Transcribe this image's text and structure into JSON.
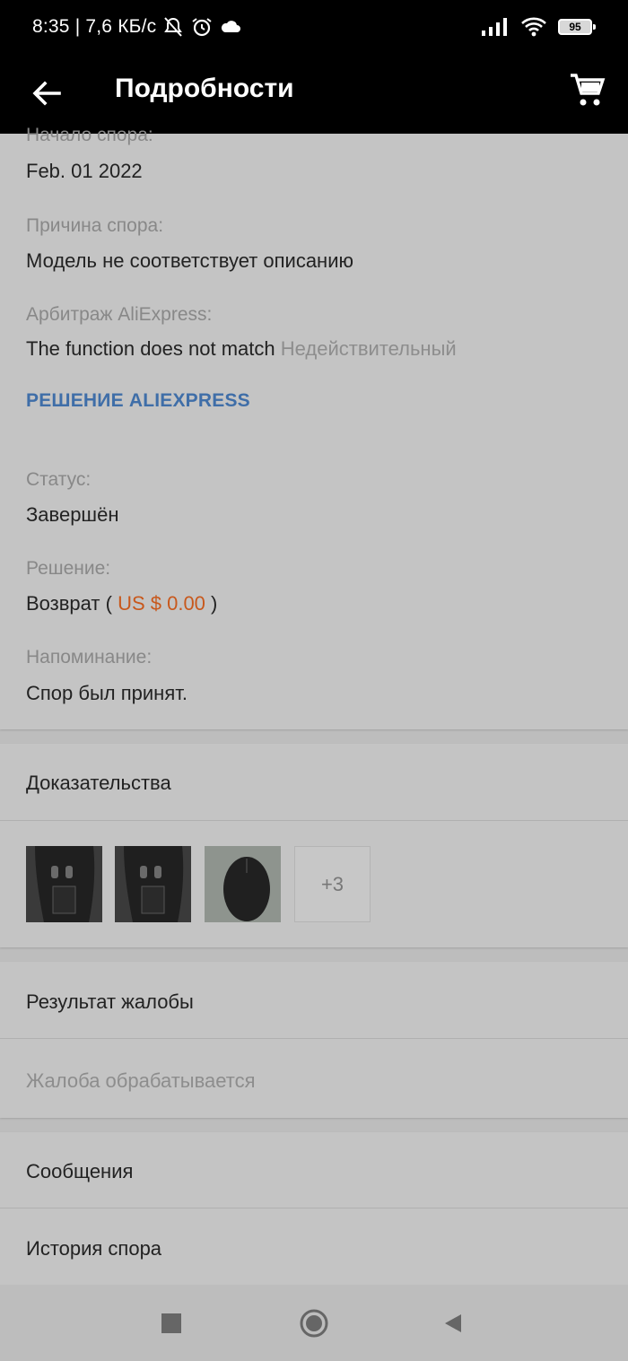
{
  "status_bar": {
    "time": "8:35",
    "speed": "| 7,6 КБ/с",
    "battery": "95",
    "icons": [
      "mute-icon",
      "alarm-icon",
      "cloud-icon",
      "signal-icon",
      "wifi-icon",
      "battery-icon"
    ]
  },
  "header": {
    "title": "Подробности",
    "back_icon": "arrow-left-icon",
    "cart_icon": "cart-icon"
  },
  "details": {
    "dispute_start_label": "Начало спора:",
    "dispute_start_value": "Feb. 01 2022",
    "reason_label": "Причина спора:",
    "reason_value": "Модель не соответствует описанию",
    "arbitration_label": "Арбитраж AliExpress:",
    "arbitration_value": "The function does not match",
    "arbitration_status": "Недействительный",
    "decision_link": "РЕШЕНИЕ ALIEXPRESS",
    "status_label": "Статус:",
    "status_value": "Завершён",
    "resolution_label": "Решение:",
    "resolution_prefix": "Возврат (",
    "resolution_amount": "US $ 0.00",
    "resolution_suffix": ")",
    "reminder_label": "Напоминание:",
    "reminder_value": "Спор был принят."
  },
  "evidence": {
    "title": "Доказательства",
    "more_count": "+3"
  },
  "complaint": {
    "title": "Результат жалобы",
    "status": "Жалоба обрабатывается"
  },
  "menu": {
    "messages": "Сообщения",
    "history": "История спора"
  },
  "colors": {
    "accent_link": "#3f6ea8",
    "price": "#c8581c",
    "header_bg": "#000000"
  }
}
